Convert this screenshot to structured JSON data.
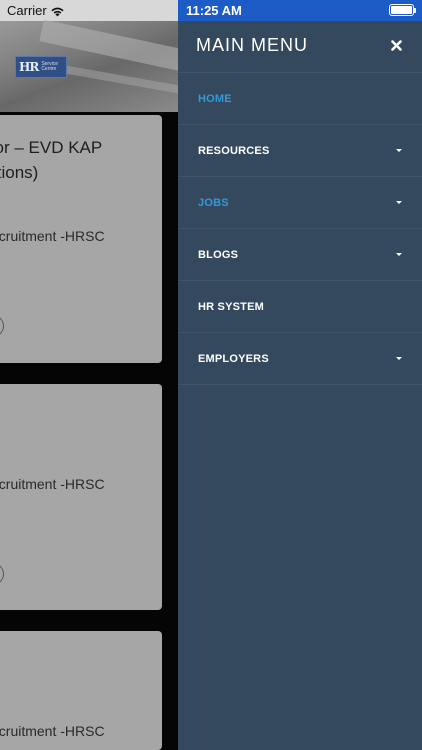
{
  "status_bar": {
    "carrier": "Carrier",
    "time": "11:25 AM"
  },
  "background": {
    "logo_text": "HR",
    "logo_subtext": "Service Centre",
    "cards": [
      {
        "title_line1": "sor – EVD KAP",
        "title_line2": "itions)",
        "org": "ecruitment -HRSC"
      },
      {
        "title_line1": "",
        "title_line2": "",
        "org": "ecruitment -HRSC"
      },
      {
        "title_line1": "",
        "title_line2": "",
        "org": "ecruitment -HRSC"
      }
    ]
  },
  "menu": {
    "title": "MAIN MENU",
    "close_icon": "close-icon",
    "items": [
      {
        "label": "HOME",
        "active": true,
        "has_submenu": false
      },
      {
        "label": "RESOURCES",
        "active": false,
        "has_submenu": true
      },
      {
        "label": "JOBS",
        "active": true,
        "has_submenu": true
      },
      {
        "label": "BLOGS",
        "active": false,
        "has_submenu": true
      },
      {
        "label": "HR SYSTEM",
        "active": false,
        "has_submenu": false
      },
      {
        "label": "EMPLOYERS",
        "active": false,
        "has_submenu": true
      }
    ]
  },
  "colors": {
    "menu_background": "#34495e",
    "active_item": "#3498db",
    "status_bar_right": "#1d5bc7"
  }
}
